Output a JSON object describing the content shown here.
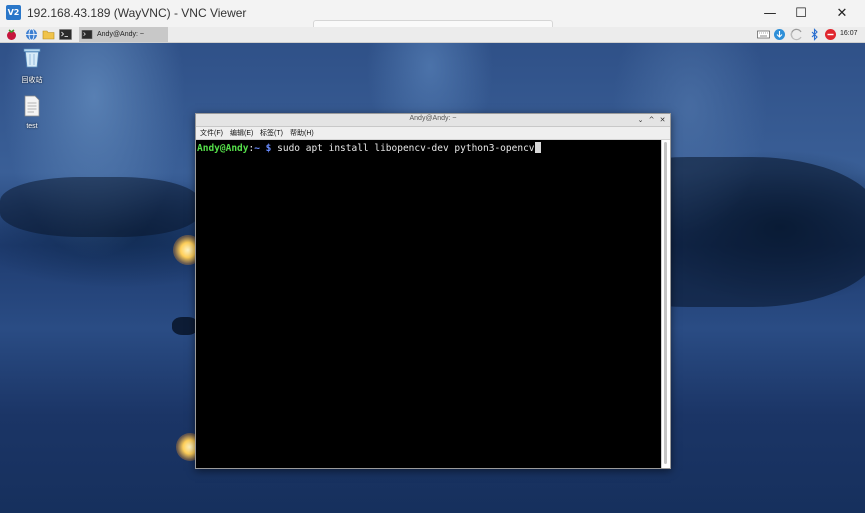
{
  "vnc": {
    "logo": "V2",
    "title": "192.168.43.189 (WayVNC) - VNC Viewer",
    "controls": [
      "—",
      "☐",
      "✕"
    ]
  },
  "taskbar": {
    "launchers": [
      "raspberry-menu-icon",
      "web-browser-icon",
      "file-manager-icon",
      "terminal-icon"
    ],
    "task_label": "Andy@Andy: ~",
    "tray_icons": [
      "keyboard-icon",
      "update-icon",
      "network-icon",
      "bluetooth-icon",
      "volume-mute-icon"
    ],
    "clock": "16:07"
  },
  "desktop": {
    "icons": [
      {
        "name": "trash-icon",
        "label": "回收站"
      },
      {
        "name": "file-icon",
        "label": "test"
      }
    ]
  },
  "terminal": {
    "title": "Andy@Andy: ~",
    "controls": [
      "⌄",
      "^",
      "✕"
    ],
    "menu": [
      "文件(F)",
      "编辑(E)",
      "标签(T)",
      "帮助(H)"
    ],
    "prompt_user": "Andy@Andy",
    "prompt_sep": ":",
    "prompt_path": "~",
    "prompt_dollar": " $ ",
    "command": "sudo apt install libopencv-dev python3-opencv"
  }
}
